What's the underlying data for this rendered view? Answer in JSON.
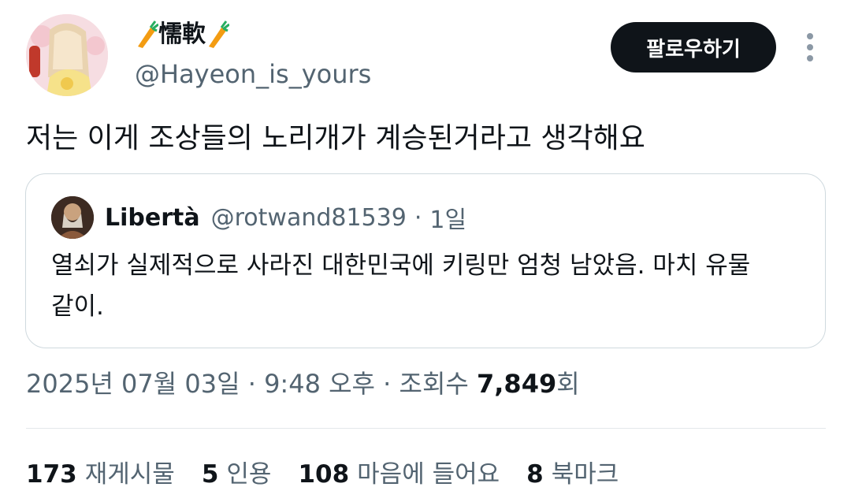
{
  "tweet": {
    "display_name": "懦軟",
    "name_decoration_icon": "carrot-emoji",
    "handle": "@Hayeon_is_yours",
    "follow_label": "팔로우하기",
    "more_icon": "more-vertical-icon",
    "text": "저는 이게 조상들의 노리개가 계승된거라고 생각해요"
  },
  "quote": {
    "name": "Libertà",
    "handle": "@rotwand81539",
    "separator": "·",
    "time": "1일",
    "text": "열쇠가 실제적으로 사라진 대한민국에 키링만 엄청 남았음. 마치 유물같이."
  },
  "meta": {
    "date": "2025년 07월 03일",
    "sep1": "·",
    "time": "9:48 오후",
    "sep2": "·",
    "views_label": "조회수",
    "views_count": "7,849",
    "views_suffix": "회"
  },
  "stats": [
    {
      "count": "173",
      "label": "재게시물"
    },
    {
      "count": "5",
      "label": "인용"
    },
    {
      "count": "108",
      "label": "마음에 들어요"
    },
    {
      "count": "8",
      "label": "북마크"
    }
  ],
  "colors": {
    "text_primary": "#0f1419",
    "text_secondary": "#536471",
    "border": "#cfd9de",
    "button_bg": "#0f1419"
  }
}
